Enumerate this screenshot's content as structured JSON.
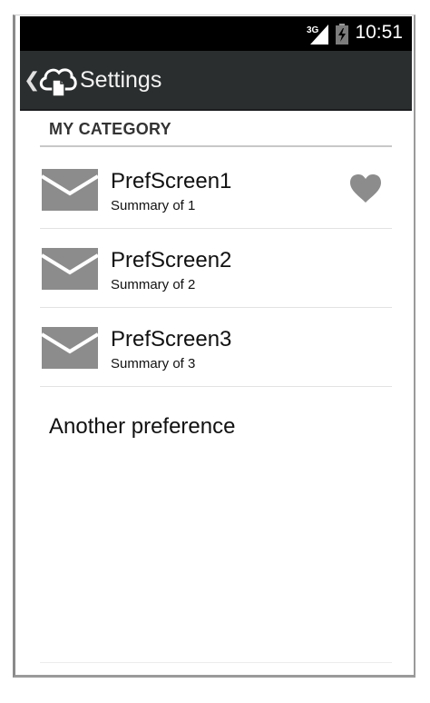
{
  "status_bar": {
    "network": "3G",
    "time": "10:51",
    "signal_icon": "signal-icon",
    "battery_icon": "battery-charging-icon"
  },
  "action_bar": {
    "up_icon": "chevron-left-icon",
    "app_icon": "cloud-document-icon",
    "title": "Settings"
  },
  "category": {
    "label": "MY CATEGORY"
  },
  "preferences": [
    {
      "title": "PrefScreen1",
      "summary": "Summary of 1",
      "icon": "mail-icon",
      "widget_icon": "heart-icon"
    },
    {
      "title": "PrefScreen2",
      "summary": "Summary of 2",
      "icon": "mail-icon"
    },
    {
      "title": "PrefScreen3",
      "summary": "Summary of 3",
      "icon": "mail-icon"
    }
  ],
  "another_preference": {
    "title": "Another preference"
  },
  "colors": {
    "status_bar_bg": "#000000",
    "action_bar_bg": "#2b2e2f",
    "icon_gray": "#8c8c8c",
    "text": "#111111"
  }
}
